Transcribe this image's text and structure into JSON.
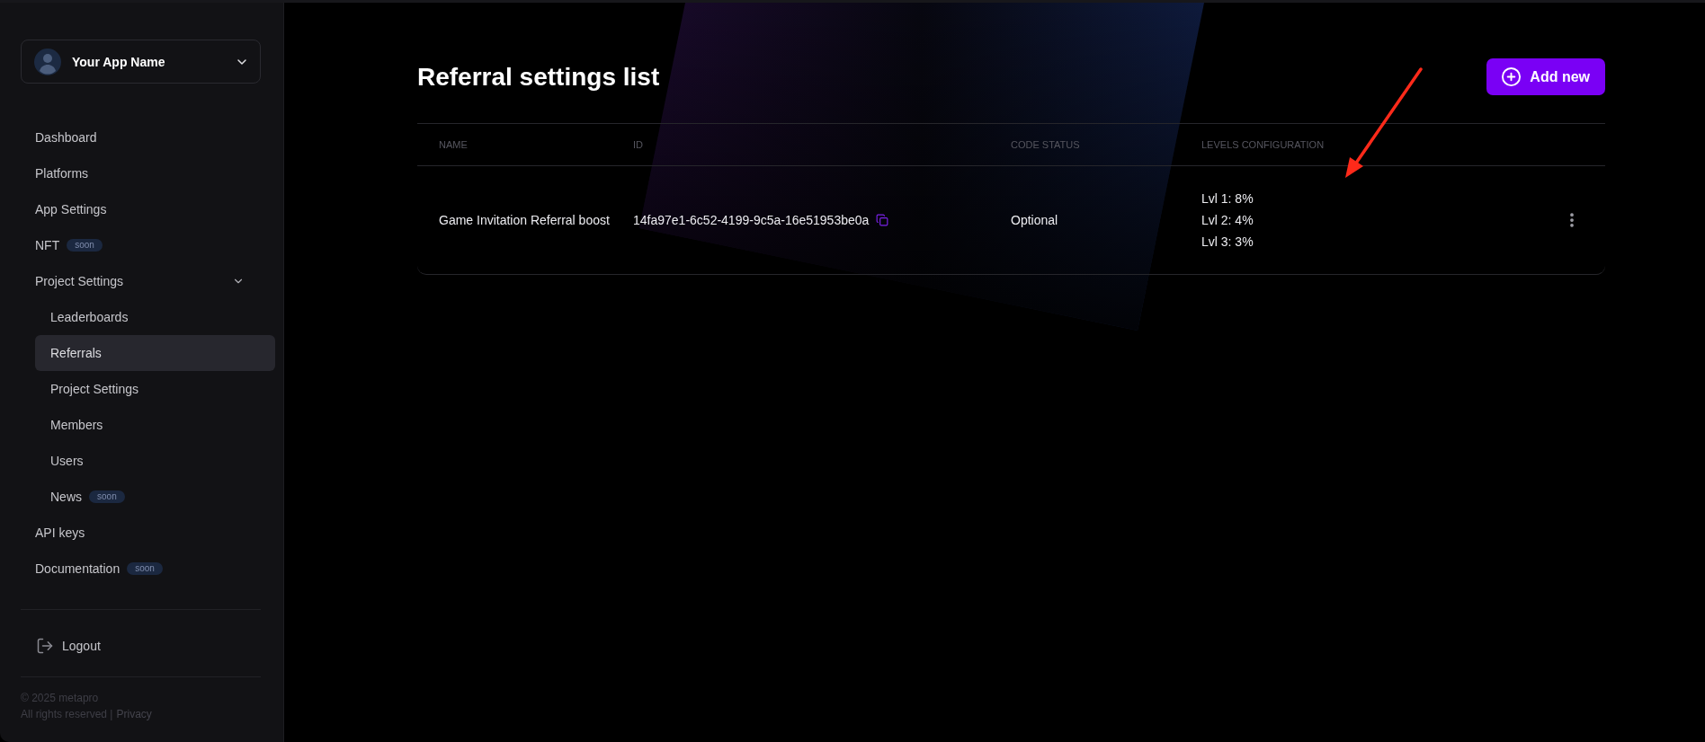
{
  "sidebar": {
    "app_selector": {
      "name": "Your App Name"
    },
    "nav": [
      {
        "label": "Dashboard",
        "selected": false
      },
      {
        "label": "Platforms",
        "selected": false
      },
      {
        "label": "App Settings",
        "selected": false
      },
      {
        "label": "NFT",
        "badge": "soon",
        "selected": false
      },
      {
        "label": "Project Settings",
        "selected": false,
        "expanded": true,
        "children": [
          {
            "label": "Leaderboards",
            "selected": false
          },
          {
            "label": "Referrals",
            "selected": true
          },
          {
            "label": "Project Settings",
            "selected": false
          },
          {
            "label": "Members",
            "selected": false
          },
          {
            "label": "Users",
            "selected": false
          },
          {
            "label": "News",
            "badge": "soon",
            "selected": false
          }
        ]
      },
      {
        "label": "API keys",
        "selected": false
      },
      {
        "label": "Documentation",
        "badge": "soon",
        "selected": false
      }
    ],
    "logout": {
      "label": "Logout"
    },
    "footer": {
      "copyright": "© 2025 metapro",
      "rights": "All rights reserved |",
      "privacy_link": "Privacy"
    }
  },
  "page": {
    "title": "Referral settings list",
    "add_button": {
      "label": "Add new"
    }
  },
  "table": {
    "columns": [
      "NAME",
      "ID",
      "CODE STATUS",
      "LEVELS CONFIGURATION"
    ],
    "rows": [
      {
        "name": "Game Invitation Referral boost",
        "id": "14fa97e1-6c52-4199-9c5a-16e51953be0a",
        "code_status": "Optional",
        "levels": [
          "Lvl 1: 8%",
          "Lvl 2: 4%",
          "Lvl 3: 3%"
        ]
      }
    ]
  }
}
